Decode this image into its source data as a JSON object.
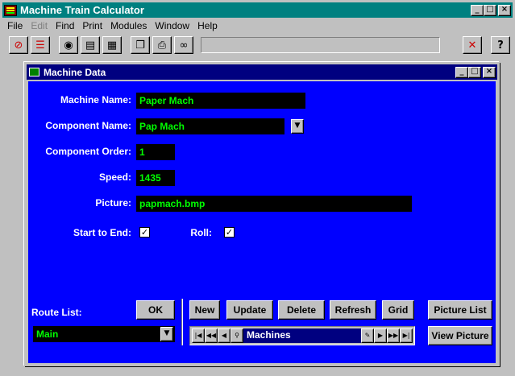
{
  "app": {
    "title": "Machine Train Calculator",
    "window_buttons": [
      "_",
      "□",
      "×"
    ]
  },
  "menu": {
    "items": [
      {
        "label": "File",
        "enabled": true
      },
      {
        "label": "Edit",
        "enabled": false
      },
      {
        "label": "Find",
        "enabled": true
      },
      {
        "label": "Print",
        "enabled": true
      },
      {
        "label": "Modules",
        "enabled": true
      },
      {
        "label": "Window",
        "enabled": true
      },
      {
        "label": "Help",
        "enabled": true
      }
    ]
  },
  "toolbar": {
    "buttons": [
      {
        "icon": "no-entry-icon",
        "glyph": "⊘",
        "color": "#cc0000"
      },
      {
        "icon": "grid-icon",
        "glyph": "☰",
        "color": "#cc0000"
      },
      {
        "icon": "gear-icon",
        "glyph": "◉",
        "color": "#000000"
      },
      {
        "icon": "layout-icon",
        "glyph": "▤",
        "color": "#000000"
      },
      {
        "icon": "network-icon",
        "glyph": "▦",
        "color": "#000000"
      },
      {
        "icon": "copy-icon",
        "glyph": "❐",
        "color": "#000000"
      },
      {
        "icon": "printer-icon",
        "glyph": "⎙",
        "color": "#000000"
      },
      {
        "icon": "binoculars-icon",
        "glyph": "∞",
        "color": "#000000"
      }
    ],
    "close_glyph": "✕",
    "help_glyph": "?"
  },
  "machine_data": {
    "title": "Machine Data",
    "labels": {
      "machine_name": "Machine Name:",
      "component_name": "Component Name:",
      "component_order": "Component Order:",
      "speed": "Speed:",
      "picture": "Picture:",
      "start_to_end": "Start to End:",
      "roll": "Roll:",
      "route_list": "Route List:"
    },
    "values": {
      "machine_name": "Paper Mach",
      "component_name": "Pap Mach",
      "component_order": "1",
      "speed": "1435",
      "picture": "papmach.bmp",
      "route_list": "Main"
    },
    "checks": {
      "start_to_end": "✓",
      "roll": "✓"
    },
    "buttons": {
      "ok": "OK",
      "new": "New",
      "update": "Update",
      "delete": "Delete",
      "refresh": "Refresh",
      "grid": "Grid",
      "picture_list": "Picture List",
      "view_picture": "View Picture"
    },
    "navigator": {
      "caption": "Machines"
    }
  }
}
